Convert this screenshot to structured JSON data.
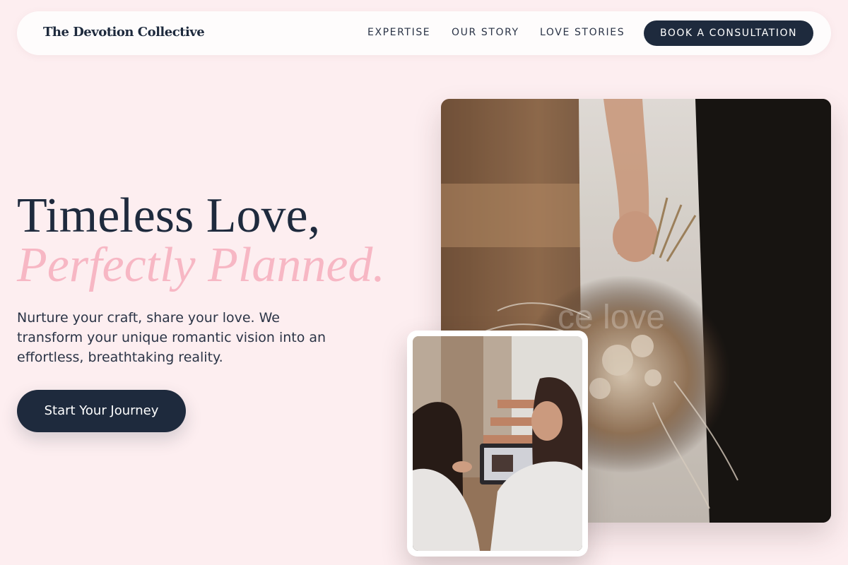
{
  "nav": {
    "brand": "The Devotion Collective",
    "links": [
      "EXPERTISE",
      "OUR STORY",
      "LOVE STORIES"
    ],
    "cta_label": "BOOK A CONSULTATION"
  },
  "hero": {
    "title_line1": "Timeless Love,",
    "title_line2": "Perfectly Planned.",
    "description": "Nurture your craft, share your love. We transform your unique romantic vision into an effortless, breathtaking reality.",
    "cta_label": "Start Your Journey"
  },
  "images": {
    "main_watermark": "ce love"
  },
  "colors": {
    "background": "#fdeef0",
    "navy": "#1e2a3d",
    "accent_pink": "#f7b7c4"
  }
}
